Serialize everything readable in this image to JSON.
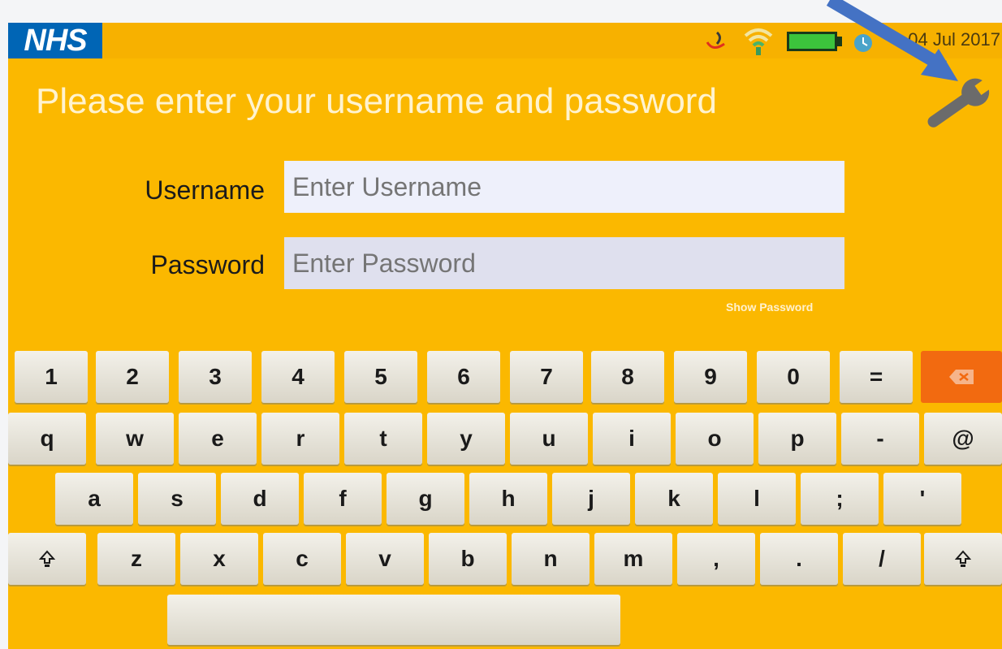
{
  "statusbar": {
    "logo": "NHS",
    "date": "04 Jul 2017",
    "icons": [
      "gesture-icon",
      "wifi-icon",
      "battery-icon",
      "clock-icon"
    ]
  },
  "login": {
    "prompt": "Please enter your username and password",
    "username_label": "Username",
    "username_placeholder": "Enter Username",
    "password_label": "Password",
    "password_placeholder": "Enter Password",
    "show_password": "Show Password"
  },
  "settings_icon": "wrench-icon",
  "annotation": "blue-arrow-pointing-at-wrench",
  "keyboard": {
    "row1": [
      "1",
      "2",
      "3",
      "4",
      "5",
      "6",
      "7",
      "8",
      "9",
      "0",
      "="
    ],
    "row2": [
      "q",
      "w",
      "e",
      "r",
      "t",
      "y",
      "u",
      "i",
      "o",
      "p",
      "-",
      "@"
    ],
    "row3": [
      "a",
      "s",
      "d",
      "f",
      "g",
      "h",
      "j",
      "k",
      "l",
      ";",
      "'"
    ],
    "row4": [
      "z",
      "x",
      "c",
      "v",
      "b",
      "n",
      "m",
      ",",
      ".",
      "/"
    ],
    "backspace_icon": "backspace-icon",
    "shift_icon": "shift-icon"
  },
  "colors": {
    "background": "#fbb800",
    "nhs_blue": "#0065b5",
    "backspace": "#f26a10",
    "arrow": "#4472c4"
  }
}
